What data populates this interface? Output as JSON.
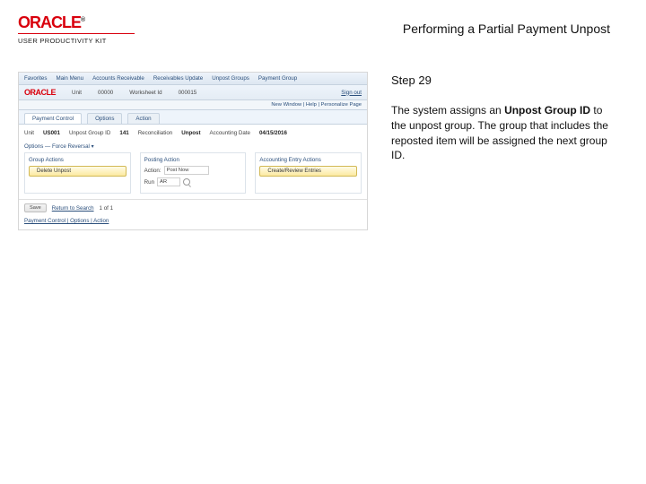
{
  "brand": {
    "logo": "ORACLE",
    "tm": "®",
    "subline": "USER PRODUCTIVITY KIT"
  },
  "page_title": "Performing a Partial Payment Unpost",
  "side": {
    "step": "Step 29",
    "p1a": "The system assigns an ",
    "p1b": "Unpost Group ID",
    "p1c": " to the unpost group. The group that includes the reposted item will be assigned the next group ID."
  },
  "shot": {
    "menu": [
      "Favorites",
      "Main Menu",
      "Accounts Receivable",
      "Receivables Update",
      "Unpost Groups",
      "Payment Group"
    ],
    "logo": "ORACLE",
    "center": {
      "k1": "Unit",
      "v1": "00000",
      "k2": "Worksheet Id",
      "v2": "000015"
    },
    "signout": "Sign out",
    "util": "New Window | Help | Personalize Page",
    "tabs": [
      "Payment Control",
      "Options",
      "Action"
    ],
    "fields": {
      "unit_l": "Unit",
      "unit_v": "US001",
      "grp_l": "Unpost Group ID",
      "grp_v": "141",
      "rsn_l": "Reconciliation",
      "rsn_v": "Unpost",
      "acc_l": "Accounting Date",
      "acc_v": "04/15/2016"
    },
    "section": "Options — Force Reversal ▾",
    "panels": {
      "left": {
        "head": "Group Actions",
        "btn": "Delete Unpost"
      },
      "mid": {
        "head": "Posting Action",
        "act_l": "Action:",
        "act_v": "Post Now",
        "run_l": "Run",
        "run_v": "AR"
      },
      "right": {
        "head": "Accounting Entry Actions",
        "btn": "Create/Review Entries"
      }
    },
    "footer": {
      "save": "Save",
      "ret": "Return to Search",
      "pg": "1 of 1",
      "links": "Payment Control | Options | Action"
    }
  }
}
